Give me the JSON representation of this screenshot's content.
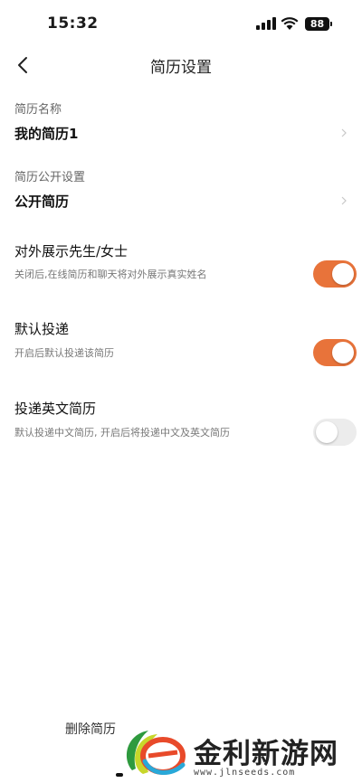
{
  "status_bar": {
    "time": "15:32",
    "battery": "88",
    "icons": [
      "signal-icon",
      "wifi-icon",
      "battery-icon"
    ]
  },
  "nav": {
    "title": "简历设置",
    "back_icon": "back-chevron-icon"
  },
  "resume_name": {
    "caption": "简历名称",
    "value": "我的简历1"
  },
  "visibility": {
    "caption": "简历公开设置",
    "value": "公开简历"
  },
  "settings": [
    {
      "title": "对外展示先生/女士",
      "description": "关闭后,在线简历和聊天将对外展示真实姓名",
      "enabled": true
    },
    {
      "title": "默认投递",
      "description": "开启后默认投递该简历",
      "enabled": true
    },
    {
      "title": "投递英文简历",
      "description": "默认投递中文简历, 开启后将投递中文及英文简历",
      "enabled": false
    }
  ],
  "footer": {
    "delete_label": "删除简历"
  },
  "watermark": {
    "text": "金利新游网",
    "url": "www.jlnseeds.com"
  },
  "colors": {
    "toggle_on": "#e8733a",
    "toggle_off": "#ececec",
    "text_primary": "#111111",
    "text_secondary": "#777777"
  }
}
